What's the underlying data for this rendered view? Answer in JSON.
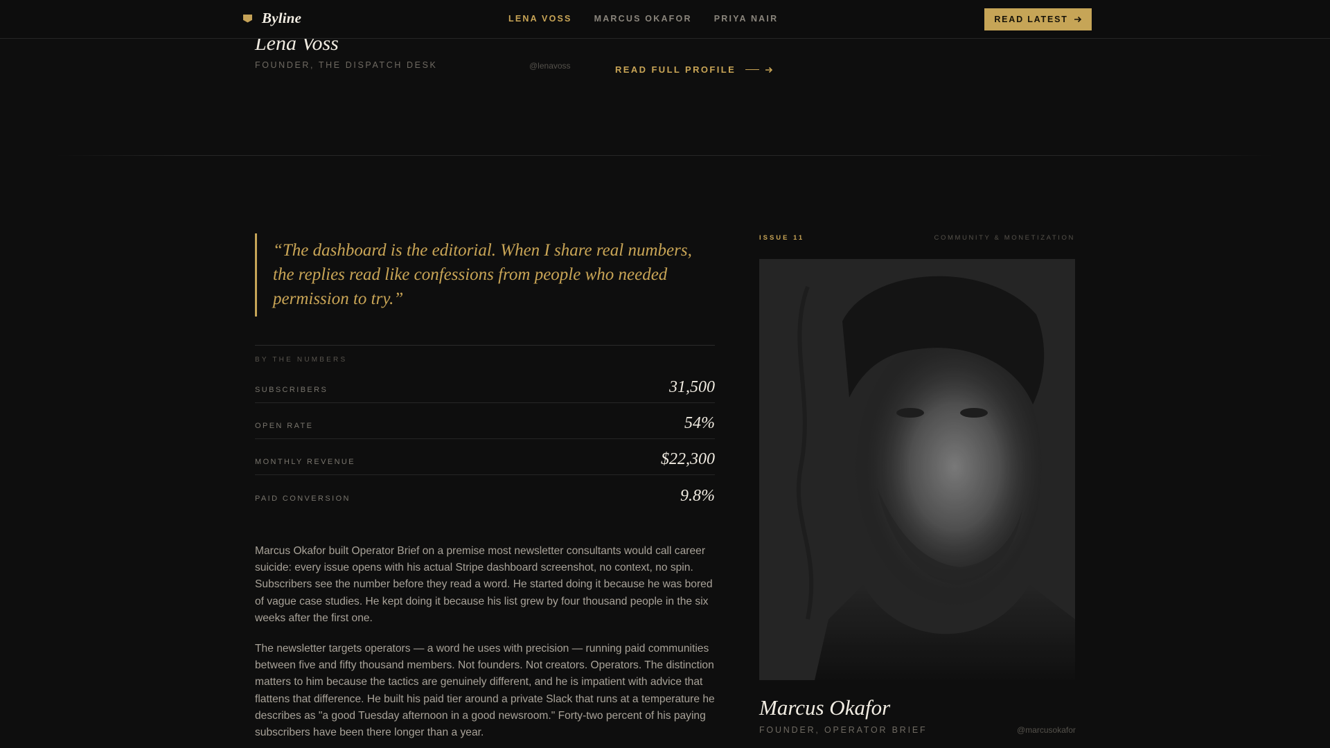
{
  "nav": {
    "brand": "Byline",
    "links": [
      {
        "label": "LENA VOSS",
        "active": true
      },
      {
        "label": "MARCUS OKAFOR",
        "active": false
      },
      {
        "label": "PRIYA NAIR",
        "active": false
      }
    ],
    "cta_label": "READ LATEST"
  },
  "previous_profile": {
    "name": "Lena Voss",
    "role": "FOUNDER, THE DISPATCH DESK",
    "handle": "@lenavoss",
    "read_full_label": "READ FULL PROFILE"
  },
  "quote": "“The dashboard is the editorial. When I share real numbers, the replies read like confessions from people who needed permission to try.”",
  "numbers": {
    "title": "BY THE NUMBERS",
    "stats": [
      {
        "label": "SUBSCRIBERS",
        "value": "31,500"
      },
      {
        "label": "OPEN RATE",
        "value": "54%"
      },
      {
        "label": "MONTHLY REVENUE",
        "value": "$22,300"
      },
      {
        "label": "PAID CONVERSION",
        "value": "9.8%"
      }
    ]
  },
  "body": [
    "Marcus Okafor built Operator Brief on a premise most newsletter consultants would call career suicide: every issue opens with his actual Stripe dashboard screenshot, no context, no spin. Subscribers see the number before they read a word. He started doing it because he was bored of vague case studies. He kept doing it because his list grew by four thousand people in the six weeks after the first one.",
    "The newsletter targets operators — a word he uses with precision — running paid communities between five and fifty thousand members. Not founders. Not creators. Operators. The distinction matters to him because the tactics are genuinely different, and he is impatient with advice that flattens that difference. He built his paid tier around a private Slack that runs at a temperature he describes as \"a good Tuesday afternoon in a good newsroom.\" Forty-two percent of his paying subscribers have been there longer than a year."
  ],
  "feature": {
    "issue": "ISSUE 11",
    "topic": "COMMUNITY & MONETIZATION",
    "name": "Marcus Okafor",
    "role": "FOUNDER, OPERATOR BRIEF",
    "handle": "@marcusokafor"
  },
  "colors": {
    "accent": "#c6a557",
    "background": "#0e0e0e",
    "text_primary": "#f0ebe1",
    "text_muted": "#a9a399"
  }
}
